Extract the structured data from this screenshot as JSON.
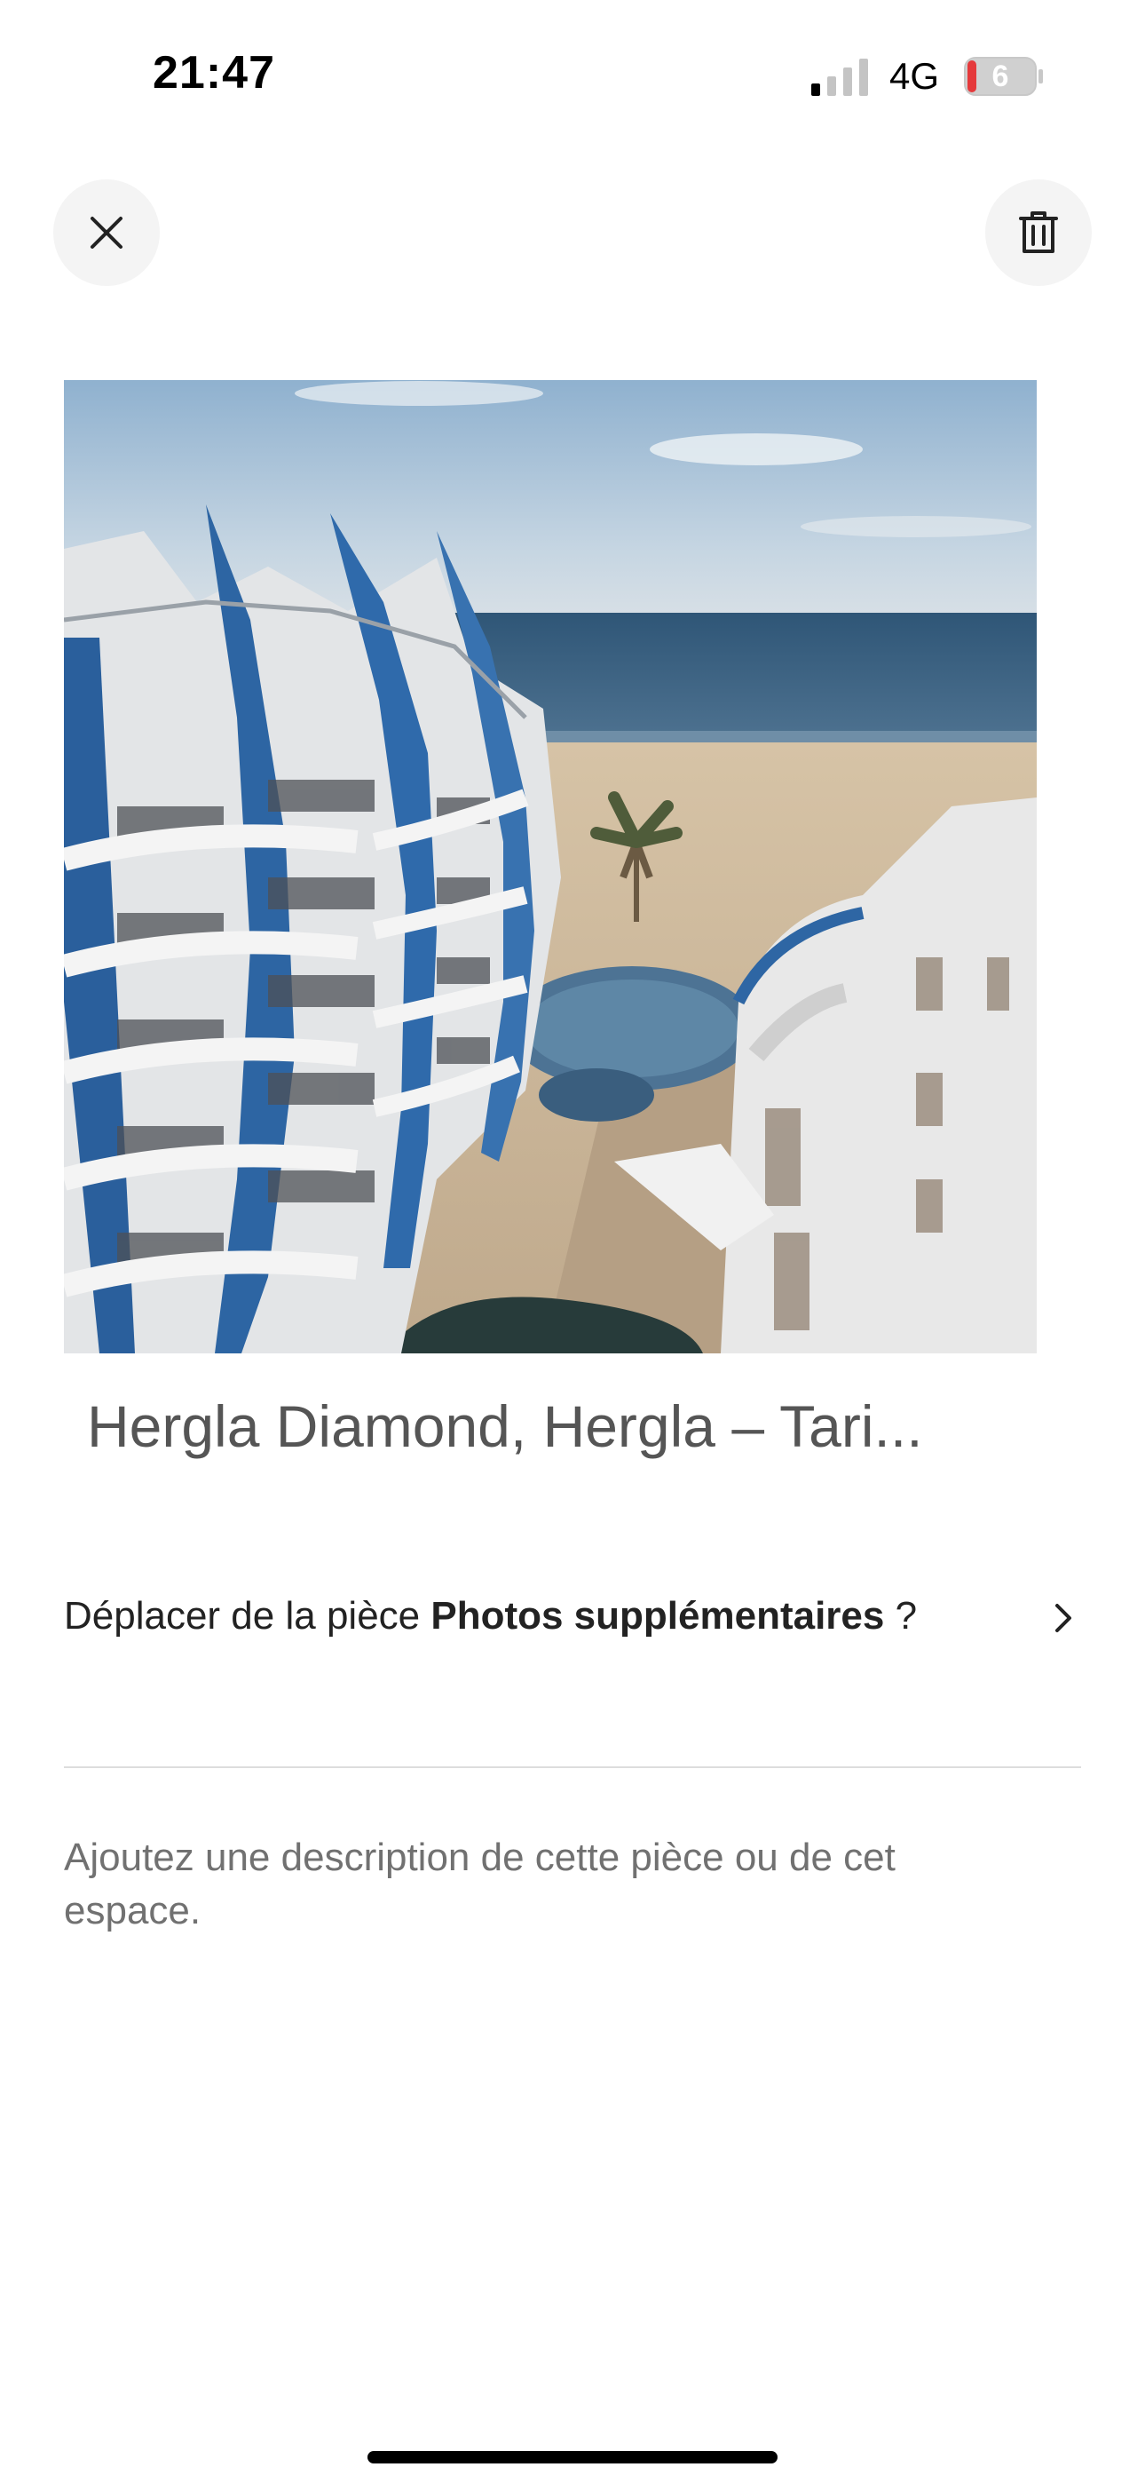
{
  "status_bar": {
    "time": "21:47",
    "network": "4G",
    "battery": "6"
  },
  "header": {
    "close_icon": "close-icon",
    "delete_icon": "trash-icon"
  },
  "photo": {
    "caption": "Hergla Diamond, Hergla – Tari..."
  },
  "move_room": {
    "prefix": "Déplacer de la pièce ",
    "room_name": "Photos supplémentaires",
    "suffix": " ?"
  },
  "description": {
    "placeholder": "Ajoutez une description de cette pièce ou de cet espace."
  },
  "colors": {
    "text_primary": "#222222",
    "text_secondary": "#717171",
    "button_bg": "#f4f4f4",
    "divider": "#dddddd"
  }
}
